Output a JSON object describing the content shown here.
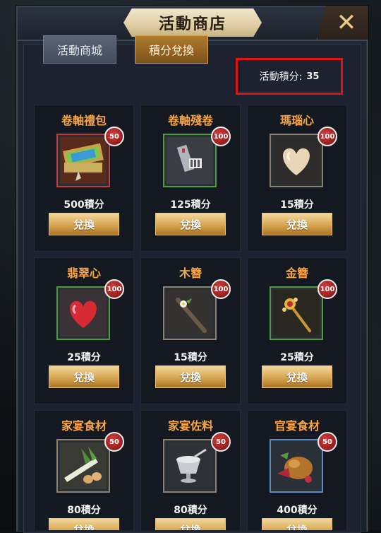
{
  "header": {
    "title": "活動商店"
  },
  "tabs": [
    {
      "label": "活動商城",
      "active": false
    },
    {
      "label": "積分兌換",
      "active": true
    }
  ],
  "points": {
    "label": "活動積分:",
    "value": "35"
  },
  "items": [
    {
      "name": "卷軸禮包",
      "qty": "50",
      "cost": "500積分",
      "button": "兌換",
      "icon": "scroll-gift-icon",
      "frame": "red"
    },
    {
      "name": "卷軸殘卷",
      "qty": "100",
      "cost": "125積分",
      "button": "兌換",
      "icon": "scroll-fragment-icon",
      "frame": "green"
    },
    {
      "name": "瑪瑙心",
      "qty": "100",
      "cost": "15積分",
      "button": "兌換",
      "icon": "agate-heart-icon",
      "frame": "tan"
    },
    {
      "name": "翡翠心",
      "qty": "100",
      "cost": "25積分",
      "button": "兌換",
      "icon": "jade-heart-icon",
      "frame": "green"
    },
    {
      "name": "木簪",
      "qty": "100",
      "cost": "15積分",
      "button": "兌換",
      "icon": "wooden-hairpin-icon",
      "frame": "tan"
    },
    {
      "name": "金簪",
      "qty": "100",
      "cost": "25積分",
      "button": "兌換",
      "icon": "gold-hairpin-icon",
      "frame": "green"
    },
    {
      "name": "家宴食材",
      "qty": "50",
      "cost": "80積分",
      "button": "兌換",
      "icon": "family-feast-ingredients-icon",
      "frame": "tan"
    },
    {
      "name": "家宴佐料",
      "qty": "50",
      "cost": "80積分",
      "button": "兌換",
      "icon": "family-feast-seasoning-icon",
      "frame": "tan"
    },
    {
      "name": "官宴食材",
      "qty": "50",
      "cost": "400積分",
      "button": "兌換",
      "icon": "official-feast-ingredients-icon",
      "frame": "blue"
    }
  ]
}
